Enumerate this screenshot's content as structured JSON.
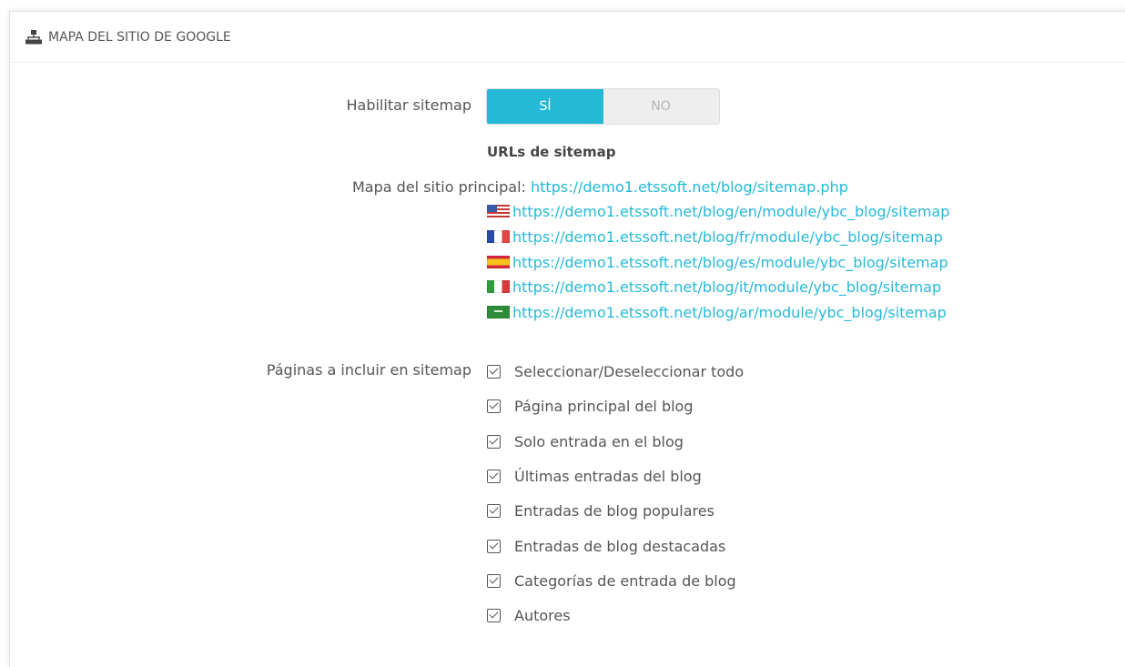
{
  "panel": {
    "title": "MAPA DEL SITIO DE GOOGLE",
    "icon": "sitemap-icon"
  },
  "enable": {
    "label": "Habilitar sitemap",
    "yes": "SÍ",
    "no": "NO",
    "selected": "SÍ"
  },
  "urls": {
    "title": "URLs de sitemap",
    "main_label": "Mapa del sitio principal:",
    "main_url": "https://demo1.etssoft.net/blog/sitemap.php",
    "languages": [
      {
        "flag": "us-flag-icon",
        "url": "https://demo1.etssoft.net/blog/en/module/ybc_blog/sitemap"
      },
      {
        "flag": "fr-flag-icon",
        "url": "https://demo1.etssoft.net/blog/fr/module/ybc_blog/sitemap"
      },
      {
        "flag": "es-flag-icon",
        "url": "https://demo1.etssoft.net/blog/es/module/ybc_blog/sitemap"
      },
      {
        "flag": "it-flag-icon",
        "url": "https://demo1.etssoft.net/blog/it/module/ybc_blog/sitemap"
      },
      {
        "flag": "sa-flag-icon",
        "url": "https://demo1.etssoft.net/blog/ar/module/ybc_blog/sitemap"
      }
    ]
  },
  "pages": {
    "label": "Páginas a incluir en sitemap",
    "options": [
      {
        "label": "Seleccionar/Deseleccionar todo",
        "checked": true
      },
      {
        "label": "Página principal del blog",
        "checked": true
      },
      {
        "label": "Solo entrada en el blog",
        "checked": true
      },
      {
        "label": "Últimas entradas del blog",
        "checked": true
      },
      {
        "label": "Entradas de blog populares",
        "checked": true
      },
      {
        "label": "Entradas de blog destacadas",
        "checked": true
      },
      {
        "label": "Categorías de entrada de blog",
        "checked": true
      },
      {
        "label": "Autores",
        "checked": true
      }
    ]
  }
}
